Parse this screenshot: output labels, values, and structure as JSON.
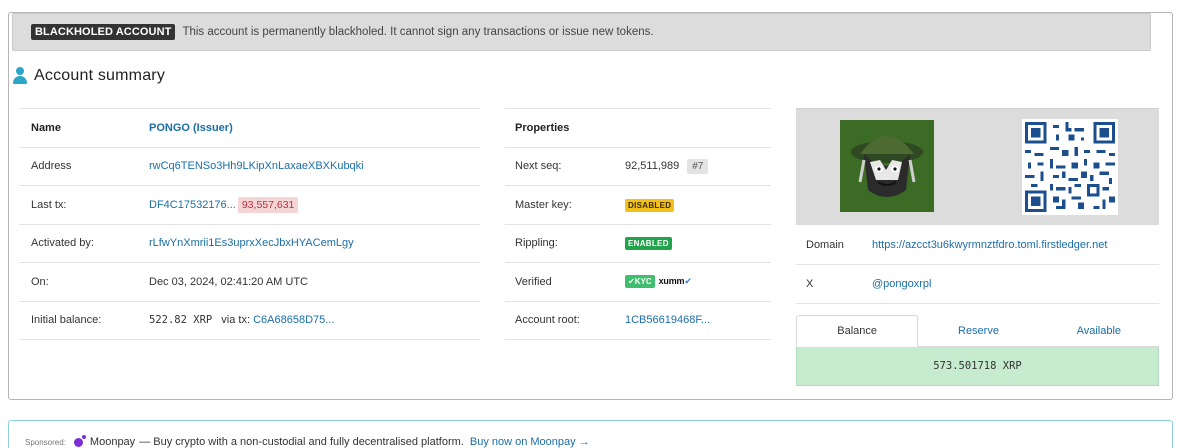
{
  "banner": {
    "tag": "BLACKHOLED ACCOUNT",
    "message": "This account is permanently blackholed. It cannot sign any transactions or issue new tokens."
  },
  "summary_title": "Account summary",
  "account": {
    "name_label": "Name",
    "name_value": "PONGO (Issuer)",
    "address_label": "Address",
    "address_value": "rwCq6TENSo3Hh9LKipXnLaxaeXBXKubqki",
    "last_tx_label": "Last tx:",
    "last_tx_hash": "DF4C17532176...",
    "last_tx_ledger": "93,557,631",
    "activated_label": "Activated by:",
    "activated_value": "rLfwYnXmrii1Es3uprxXecJbxHYACemLgy",
    "on_label": "On:",
    "on_value": "Dec 03, 2024, 02:41:20 AM UTC",
    "initial_label": "Initial balance:",
    "initial_amount": "522.82 XRP",
    "initial_via": "via tx:",
    "initial_tx": "C6A68658D75..."
  },
  "properties": {
    "header": "Properties",
    "next_seq_label": "Next seq:",
    "next_seq_value": "92,511,989",
    "next_seq_badge": "#7",
    "master_key_label": "Master key:",
    "master_key_value": "DISABLED",
    "rippling_label": "Rippling:",
    "rippling_value": "ENABLED",
    "verified_label": "Verified",
    "verified_kyc": "✔KYC",
    "verified_xumm": "xumm",
    "verified_check": "✔",
    "account_root_label": "Account root:",
    "account_root_value": "1CB56619468F..."
  },
  "details": {
    "domain_label": "Domain",
    "domain_value": "https://azcct3u6kwyrmnztfdro.toml.firstledger.net",
    "x_label": "X",
    "x_value": "@pongoxrpl"
  },
  "tabs": [
    "Balance",
    "Reserve",
    "Available"
  ],
  "balance_value": "573.501718 XRP",
  "sponsor": {
    "label": "Sponsored:",
    "brand": "Moonpay",
    "text": "— Buy crypto with a non-custodial and fully decentralised platform.",
    "link": "Buy now on Moonpay →"
  },
  "colors": {
    "link": "#1b6ea8",
    "disabled_pill": "#f2c01a",
    "enabled_pill": "#21a34a",
    "balance_bg": "#c6ebcf"
  }
}
